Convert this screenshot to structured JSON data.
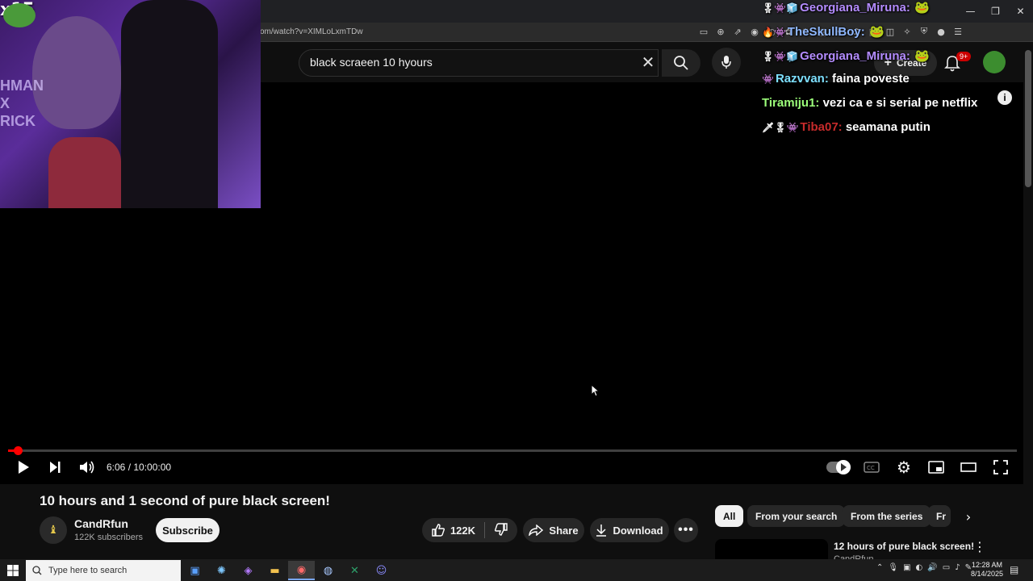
{
  "browser": {
    "url": "om/watch?v=XIMLoLxmTDw",
    "window_controls": {
      "minimize": "—",
      "restore": "❐",
      "close": "✕"
    }
  },
  "youtube_header": {
    "search_value": "black scraeen 10 hyours",
    "create_label": "Create",
    "notification_count": "9+"
  },
  "player": {
    "time_display": "6:06 / 10:00:00",
    "progress_fraction": 0.0102
  },
  "webcam": {
    "overlay_text": "x15",
    "wall_text": "HMAN\nX\nRICK"
  },
  "chat": [
    {
      "badges": "🎖👾🧊",
      "user": "Georgiana_Miruna:",
      "message": "",
      "user_color": "#b48cff",
      "emote": "🐸"
    },
    {
      "badges": "🔥👾",
      "user": "TheSkullBoy:",
      "message": "",
      "user_color": "#8fb8ff",
      "emote": "🐸"
    },
    {
      "badges": "🎖👾🧊",
      "user": "Georgiana_Miruna:",
      "message": "",
      "user_color": "#b48cff",
      "emote": "🐸"
    },
    {
      "badges": "👾",
      "user": "Razvvan:",
      "message": "faina poveste",
      "user_color": "#7ee0ff",
      "emote": ""
    },
    {
      "badges": "",
      "user": "Tiramiju1:",
      "message": "vezi ca e si serial pe netflix",
      "user_color": "#9cff7a",
      "emote": ""
    },
    {
      "badges": "🗡🎖👾",
      "user": "Tiba07:",
      "message": "seamana putin",
      "user_color": "#c62b2b",
      "emote": ""
    }
  ],
  "video": {
    "title": "10 hours and 1 second of pure black screen!",
    "channel": "CandRfun",
    "subscribers": "122K subscribers",
    "subscribe_label": "Subscribe",
    "likes": "122K",
    "share_label": "Share",
    "download_label": "Download"
  },
  "chips": [
    "All",
    "From your search",
    "From the series",
    "Fr"
  ],
  "recommendation": {
    "title": "12 hours of pure black screen!",
    "channel": "CandRfun"
  },
  "taskbar": {
    "search_placeholder": "Type here to search",
    "time": "12:28 AM",
    "date": "8/14/2025"
  },
  "colors": {
    "accent_red": "#ff0000",
    "background": "#0f0f0f"
  }
}
